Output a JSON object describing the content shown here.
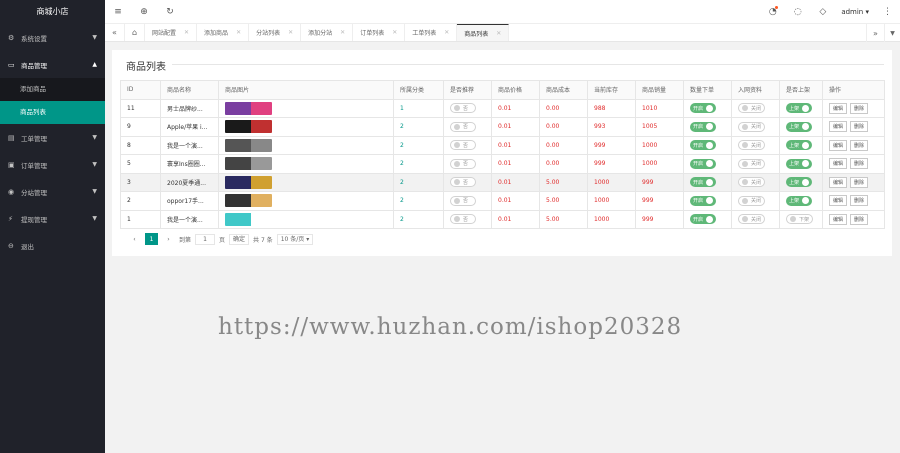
{
  "app_title": "商城小店",
  "sidebar": {
    "items": [
      {
        "label": "系统设置",
        "icon": "gear-icon",
        "glyph": "⚙"
      },
      {
        "label": "商品管理",
        "icon": "cart-icon",
        "glyph": "▭"
      },
      {
        "label": "工单管理",
        "icon": "document-icon",
        "glyph": "▤"
      },
      {
        "label": "订单管理",
        "icon": "box-icon",
        "glyph": "▣"
      },
      {
        "label": "分站管理",
        "icon": "globe-icon",
        "glyph": "◉"
      },
      {
        "label": "提现管理",
        "icon": "cash-icon",
        "glyph": "⚡"
      },
      {
        "label": "退出",
        "icon": "logout-icon",
        "glyph": "⊖"
      }
    ],
    "submenu": [
      {
        "label": "添加商品"
      },
      {
        "label": "商品列表"
      }
    ]
  },
  "header": {
    "user": "admin",
    "dropdown_arrow": "▾"
  },
  "tabs": [
    "网站配置",
    "添加商品",
    "分站列表",
    "添加分站",
    "订单列表",
    "工单列表",
    "商品列表"
  ],
  "main": {
    "title": "商品列表",
    "columns": [
      "ID",
      "商品名称",
      "商品图片",
      "所属分类",
      "是否推荐",
      "商品价格",
      "商品成本",
      "当前库存",
      "商品销量",
      "数量下单",
      "入网资料",
      "是否上架",
      "操作"
    ],
    "rows": [
      {
        "id": "11",
        "name": "男士品牌纱...",
        "category": "1",
        "recommend": "否",
        "price": "0.01",
        "cost": "0.00",
        "stock": "988",
        "sales": "1010",
        "qty_order": "开启",
        "qty_on": true,
        "network": "关闭",
        "net_on": false,
        "listed": "上架",
        "listed_on": true,
        "thumb": "#7a3ea0",
        "thumb2": "#e04080"
      },
      {
        "id": "9",
        "name": "Apple/苹果 i...",
        "category": "2",
        "recommend": "否",
        "price": "0.01",
        "cost": "0.00",
        "stock": "993",
        "sales": "1005",
        "qty_order": "开启",
        "qty_on": true,
        "network": "关闭",
        "net_on": false,
        "listed": "上架",
        "listed_on": true,
        "thumb": "#1a1a1a",
        "thumb2": "#c03030"
      },
      {
        "id": "8",
        "name": "我是一个演...",
        "category": "2",
        "recommend": "否",
        "price": "0.01",
        "cost": "0.00",
        "stock": "999",
        "sales": "1000",
        "qty_order": "开启",
        "qty_on": true,
        "network": "关闭",
        "net_on": false,
        "listed": "上架",
        "listed_on": true,
        "thumb": "#555555",
        "thumb2": "#888888"
      },
      {
        "id": "5",
        "name": "寰享Ins圈圈...",
        "category": "2",
        "recommend": "否",
        "price": "0.01",
        "cost": "0.00",
        "stock": "999",
        "sales": "1000",
        "qty_order": "开启",
        "qty_on": true,
        "network": "关闭",
        "net_on": false,
        "listed": "上架",
        "listed_on": true,
        "thumb": "#444444",
        "thumb2": "#999999"
      },
      {
        "id": "3",
        "name": "2020夏季通...",
        "category": "2",
        "recommend": "否",
        "price": "0.01",
        "cost": "5.00",
        "stock": "1000",
        "sales": "999",
        "qty_order": "开启",
        "qty_on": true,
        "network": "关闭",
        "net_on": false,
        "listed": "上架",
        "listed_on": true,
        "thumb": "#2a2a60",
        "thumb2": "#d0a030"
      },
      {
        "id": "2",
        "name": "oppor17手...",
        "category": "2",
        "recommend": "否",
        "price": "0.01",
        "cost": "5.00",
        "stock": "1000",
        "sales": "999",
        "qty_order": "开启",
        "qty_on": true,
        "network": "关闭",
        "net_on": false,
        "listed": "上架",
        "listed_on": true,
        "thumb": "#333333",
        "thumb2": "#e0b060"
      },
      {
        "id": "1",
        "name": "我是一个演...",
        "category": "2",
        "recommend": "否",
        "price": "0.01",
        "cost": "5.00",
        "stock": "1000",
        "sales": "999",
        "qty_order": "开启",
        "qty_on": true,
        "network": "关闭",
        "net_on": false,
        "listed": "下架",
        "listed_on": false,
        "thumb": "#40c8c8",
        "thumb2": "#ffffff"
      }
    ],
    "edit_label": "编辑",
    "delete_label": "删除"
  },
  "pager": {
    "prev": "‹",
    "current": "1",
    "next": "›",
    "goto_prefix": "到第",
    "goto_value": "1",
    "goto_suffix": "页",
    "confirm": "确定",
    "total": "共 7 条",
    "per_page": "10 条/页",
    "per_page_arrow": "▾"
  },
  "watermark": "https://www.huzhan.com/ishop20328",
  "colors": {
    "accent": "#009688",
    "sidebar": "#20222a",
    "switch_on": "#5fb878",
    "price": "#e02b2b"
  }
}
